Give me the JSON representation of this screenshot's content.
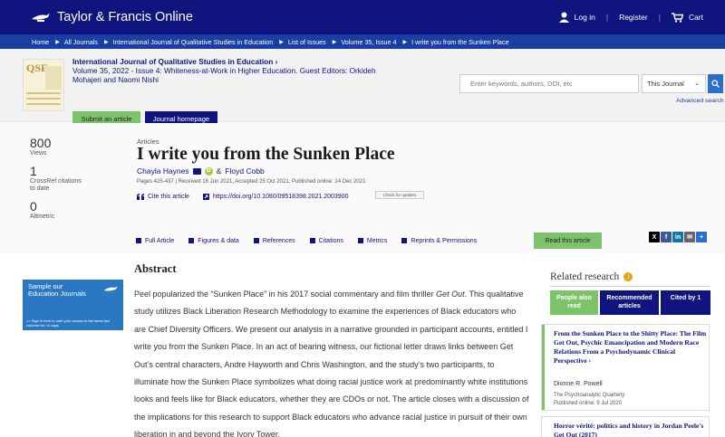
{
  "header": {
    "brand": "Taylor & Francis Online",
    "login": "Log in",
    "register": "Register",
    "cart": "Cart"
  },
  "breadcrumb": [
    "Home",
    "All Journals",
    "International Journal of Qualitative Studies in Education",
    "List of Issues",
    "Volume 35, Issue 4",
    "I write you from the Sunken Place"
  ],
  "journal": {
    "cover_text": "QSE",
    "title": "International Journal of Qualitative Studies in Education",
    "title_arrow": "›",
    "issue": "Volume 35, 2022 - Issue 4: Whiteness-at-Work in Higher Education. Guest Editors: Orkideh Mohajeri and Naomi Nishi",
    "submit_label": "Submit an article",
    "homepage_label": "Journal homepage"
  },
  "search": {
    "placeholder": "Enter keywords, authors, DOI, etc",
    "scope": "This Journal",
    "advanced": "Advanced search"
  },
  "metrics": {
    "views": "800",
    "views_label": "Views",
    "crossref": "1",
    "crossref_label": "CrossRef citations to date",
    "altmetric": "0",
    "altmetric_label": "Altmetric"
  },
  "article": {
    "kicker": "Articles",
    "title": "I write you from the Sunken Place",
    "author1": "Chayla Haynes",
    "amp": "&",
    "author2": "Floyd Cobb",
    "pages": "Pages 425-437 | Received 16 Jun 2021, Accepted 25 Oct 2021, Published online: 14 Dec 2021",
    "cite": "Cite this article",
    "doi": "https://doi.org/10.1080/09518398.2021.2003900",
    "check_updates": "Check for updates"
  },
  "tabs": [
    "Full Article",
    "Figures & data",
    "References",
    "Citations",
    "Metrics",
    "Reprints & Permissions"
  ],
  "read_label": "Read this article",
  "share": [
    {
      "icon": "x-icon",
      "glyph": "X",
      "color": "#000000"
    },
    {
      "icon": "facebook-icon",
      "glyph": "f",
      "color": "#3b5998"
    },
    {
      "icon": "linkedin-icon",
      "glyph": "in",
      "color": "#0e76a8"
    },
    {
      "icon": "email-icon",
      "glyph": "✉",
      "color": "#666666"
    },
    {
      "icon": "share-icon",
      "glyph": "+",
      "color": "#2a6fd0"
    }
  ],
  "promo": {
    "heading": "Sample our Education Journals",
    "fine": ">> Sign in here to start your access to the latest two volumes for 14 days"
  },
  "abstract": {
    "heading": "Abstract",
    "text_before": "Peel popularized the “Sunken Place” in his 2017 social commentary and film thriller ",
    "italic": "Get Out",
    "text_after": ". This qualitative study utilizes Black Liberation Research Methodology to examine the experiences of Black educators who are Chief Diversity Officers. We present our analysis in a narrative grounded in participant accounts, entitled I write you from the Sunken Place. In an act of bearing witness, our fictional letter draws links between Get Out’s central characters, Andre Hayworth and Chris Washington, and the study’s two participants, to illuminate how the Sunken Place symbolizes what doing racial justice work at predominantly white institutions looks and feels like for Black educators, whether they are CDOs or not. The article closes with a discussion of the implications for this research to support Black educators who advance racial justice in pursuit of their own liberation in and beyond the Ivory Tower."
  },
  "related": {
    "heading": "Related research",
    "tabs": [
      "People also read",
      "Recommended articles",
      "Cited by 1"
    ],
    "card1_title": "From the Sunken Place to the Shitty Place: The Film Get Out, Psychic Emancipation and Modern Race Relations From a Psychodynamic Clinical Perspective",
    "card1_arrow": "›",
    "card1_author": "Dionne R. Powell",
    "card1_journal": "The Psychoanalytic Quarterly",
    "card1_published": "Published online: 9 Jul 2020",
    "card2_title": "Horror vérité: politics and history in Jordan Peele's Get Out (2017)"
  },
  "colors": {
    "navy": "#10147e",
    "crumb_blue": "#1b3ea2",
    "green": "#7cc36b",
    "promo_blue": "#2a78c3"
  }
}
